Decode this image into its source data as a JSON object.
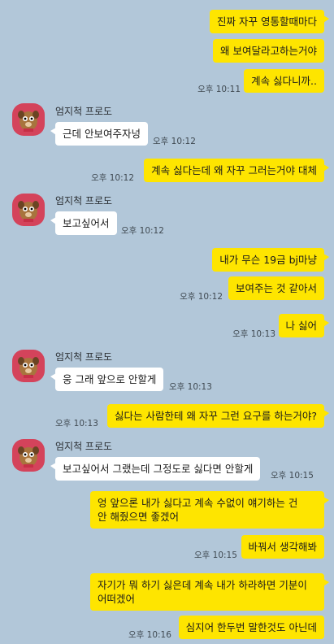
{
  "sender_name": "엄지척 프로도",
  "avatar_icon": "frodo-character-icon",
  "colors": {
    "background": "#b2c7d9",
    "outgoing": "#fee500",
    "incoming": "#ffffff",
    "avatar": "#d4435b"
  },
  "messages": [
    {
      "text": "진짜 자꾸 영통할때마다",
      "time": ""
    },
    {
      "text": "왜 보여달라고하는거야",
      "time": ""
    },
    {
      "text": "계속 싫다니까..",
      "time": "오후 10:11"
    },
    {
      "text": "근데 안보여주자넝",
      "time": "오후 10:12"
    },
    {
      "text": "계속 싫다는데 왜 자꾸 그러는거야 대체",
      "time": "오후 10:12"
    },
    {
      "text": "보고싶어서",
      "time": "오후 10:12"
    },
    {
      "text": "내가 무슨 19금 bj마냥",
      "time": ""
    },
    {
      "text": "보여주는 것 같아서",
      "time": "오후 10:12"
    },
    {
      "text": "나 싫어",
      "time": "오후 10:13"
    },
    {
      "text": "웅 그래 앞으로 안할게",
      "time": "오후 10:13"
    },
    {
      "text": "싫다는 사람한테 왜 자꾸 그런 요구를 하는거야?",
      "time": "오후 10:13"
    },
    {
      "text": "보고싶어서 그랬는데 그정도로 싫다면 안할게",
      "time": "오후 10:15"
    },
    {
      "text": "엉 앞으론 내가 싫다고 계속 수없이 얘기하는 건\n안 해줬으면 좋겠어",
      "time": ""
    },
    {
      "text": "바꿔서 생각해봐",
      "time": "오후 10:15"
    },
    {
      "text": "자기가 뭐 하기 싫은데 계속 내가 하라하면 기분이\n어떠겠어",
      "time": ""
    },
    {
      "text": "심지어 한두번 말한것도 아닌데",
      "time": "오후 10:16"
    }
  ]
}
